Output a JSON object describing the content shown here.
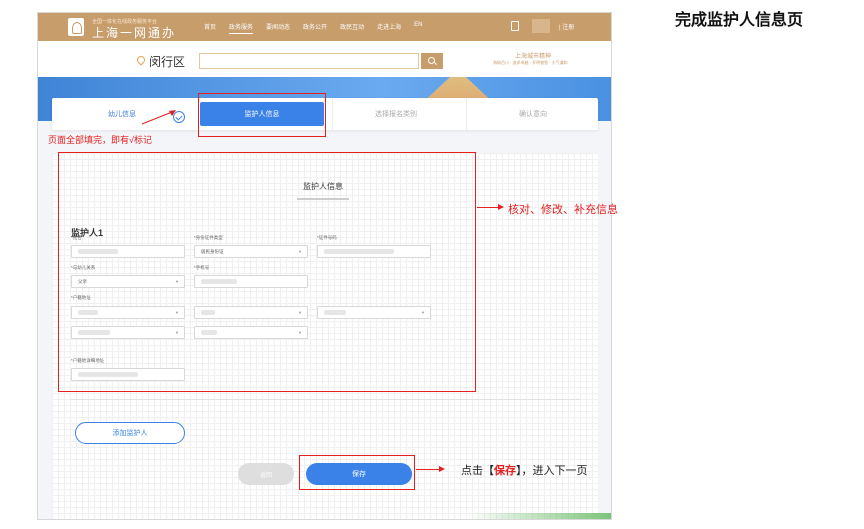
{
  "page_title": "完成监护人信息页",
  "header": {
    "site_small": "全国一体化在线政务服务平台",
    "site_title": "上海一网通办",
    "nav": [
      "首页",
      "政务服务",
      "要闻动态",
      "政务公开",
      "政民互动",
      "走进上海",
      "EN"
    ],
    "login": "| 注册"
  },
  "district_bar": {
    "district": "闵行区",
    "search_placeholder": "",
    "spirit_title": "上海城市精神",
    "spirit_sub": "海纳百川 · 追求卓越 · 开明睿智 · 大气谦和"
  },
  "steps": [
    {
      "label": "幼儿信息",
      "state": "done"
    },
    {
      "label": "监护人信息",
      "state": "active"
    },
    {
      "label": "选择报名类别",
      "state": "pending"
    },
    {
      "label": "确认意向",
      "state": "pending"
    }
  ],
  "form": {
    "section_title": "监护人信息",
    "person_title": "监护人1",
    "fields": {
      "name_label": "*姓名",
      "id_type_label": "*身份证件类型",
      "id_type_value": "居民身份证",
      "id_no_label": "*证件号码",
      "relation_label": "*与幼儿关系",
      "relation_value": "父亲",
      "phone_label": "*手机号",
      "household_label": "*户籍地址",
      "household_detail_label": "*户籍地详细地址"
    },
    "add_guardian": "添加监护人",
    "back": "返回",
    "save": "保存"
  },
  "annotations": {
    "all_filled": "页面全部填完，即有√标记",
    "verify": "核对、修改、补充信息",
    "click_prefix": "点击【",
    "click_save": "保存",
    "click_suffix": "】，进入下一页"
  },
  "colors": {
    "header_brown": "#c79d6c",
    "primary_blue": "#3b82e8",
    "annotation_red": "#e52020"
  }
}
